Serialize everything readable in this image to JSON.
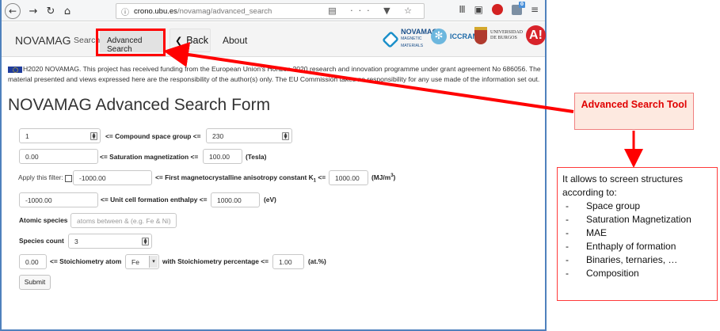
{
  "browser": {
    "url_domain": "crono.ubu.es",
    "url_path": "/novamag/advanced_search",
    "icons": [
      "back-icon",
      "forward-icon",
      "reload-icon",
      "home-icon",
      "info-icon",
      "reader-icon",
      "menu-dots-icon",
      "pocket-icon",
      "bookmark-star-icon",
      "library-icon",
      "sidebar-icon",
      "adblock-icon",
      "extension-icon",
      "hamburger-menu-icon"
    ],
    "glyphs": {
      "back": "←",
      "forward": "→",
      "reload": "↻",
      "home": "⌂",
      "info": "ⓘ",
      "url_right": "▤ ··· ▼ ☆",
      "library": "Ⅲ",
      "sidebar": "▣",
      "menu": "≡",
      "ext_badge": "0"
    }
  },
  "navbar": {
    "brand": "NOVAMAG",
    "search": "Search",
    "advanced_search": "Advanced Search",
    "back": "Back",
    "about": "About",
    "logo_novamag": "NOVAMAG",
    "logo_novamag_sub": "MAGNETIC MATERIALS",
    "logo_iccram": "ICCRAM",
    "logo_ubu_line1": "UNIVERSIDAD",
    "logo_ubu_line2": "DE BURGOS",
    "logo_a": "A!"
  },
  "funding_text": "H2020 NOVAMAG. This project has received funding from the European Union's Horizon 2020 research and innovation programme under grant agreement No 686056. The material presented and views expressed here are the responsibility of the author(s) only. The EU Commission takes no responsibility for any use made of the information set out.",
  "form": {
    "title": "NOVAMAG Advanced Search Form",
    "space_group_min": "1",
    "space_group_label": "<= Compound space group <=",
    "space_group_max": "230",
    "sat_mag_min": "0.00",
    "sat_mag_label": "<= Saturation magnetization <=",
    "sat_mag_max": "100.00",
    "sat_mag_unit": "(Tesla)",
    "apply_filter_label": "Apply this filter:",
    "anis_min": "-1000.00",
    "anis_label_pre": "<= First magnetocrystalline anisotropy constant K",
    "anis_label_sub": "1",
    "anis_label_post": " <=",
    "anis_max": "1000.00",
    "anis_unit_pre": "(MJ/m",
    "anis_unit_sup": "3",
    "anis_unit_post": ")",
    "enthalpy_min": "-1000.00",
    "enthalpy_label": "<= Unit cell formation enthalpy <=",
    "enthalpy_max": "1000.00",
    "enthalpy_unit": "(eV)",
    "atomic_species_label": "Atomic species",
    "atomic_species_placeholder": "atoms between & (e.g. Fe & Ni)",
    "species_count_label": "Species count",
    "species_count_value": "3",
    "stoich_min": "0.00",
    "stoich_label": "<= Stoichiometry atom",
    "stoich_atom": "Fe",
    "stoich_pct_label": "with Stoichiometry percentage <=",
    "stoich_pct": "1.00",
    "stoich_unit": "(at.%)",
    "submit": "Submit"
  },
  "annotation": {
    "callout": "Advanced Search Tool",
    "intro": "It allows to screen structures according to:",
    "items": [
      "Space group",
      "Saturation Magnetization",
      "MAE",
      "Enthaply of formation",
      "Binaries, ternaries, …",
      "Composition"
    ],
    "highlight_color": "#ff0000"
  }
}
